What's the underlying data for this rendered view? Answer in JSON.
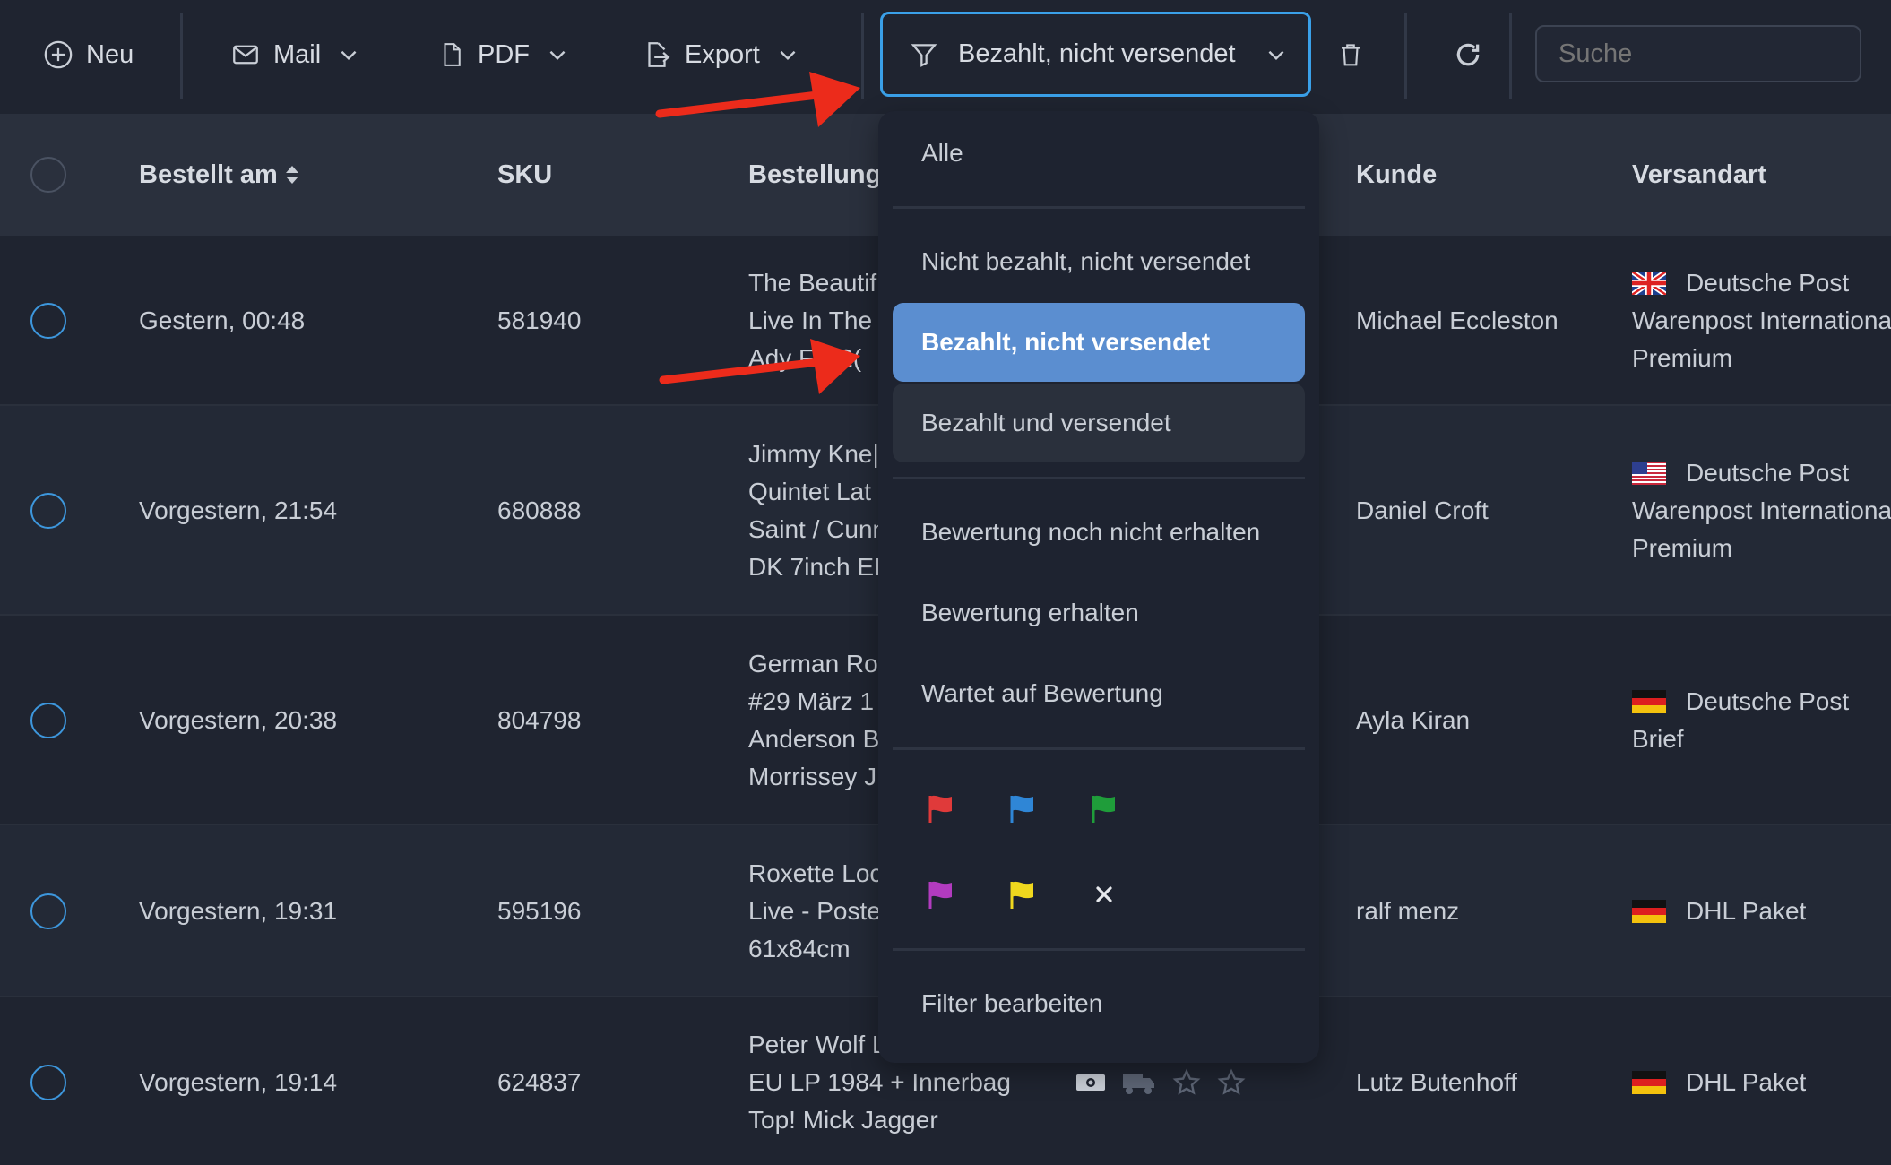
{
  "toolbar": {
    "new_label": "Neu",
    "mail_label": "Mail",
    "pdf_label": "PDF",
    "export_label": "Export",
    "filter_label": "Bezahlt, nicht versendet",
    "search_placeholder": "Suche"
  },
  "table": {
    "headers": {
      "ordered_at": "Bestellt am",
      "sku": "SKU",
      "order": "Bestellung",
      "customer": "Kunde",
      "shipping": "Versandart"
    },
    "rows": [
      {
        "date": "Gestern, 00:48",
        "sku": "581940",
        "order_lines": [
          "The Beautif",
          "Live In The",
          "Ady F... 2("
        ],
        "customer": "Michael Eccleston",
        "flag": "uk",
        "shipping_lines": [
          "Deutsche Post",
          "Warenpost Internationa",
          "Premium"
        ]
      },
      {
        "date": "Vorgestern, 21:54",
        "sku": "680888",
        "order_lines": [
          "Jimmy Kne|",
          "Quintet Lat",
          "Saint / Cunn",
          "DK 7inch EI"
        ],
        "customer": "Daniel Croft",
        "flag": "us",
        "shipping_lines": [
          "Deutsche Post",
          "Warenpost Internationa",
          "Premium"
        ]
      },
      {
        "date": "Vorgestern, 20:38",
        "sku": "804798",
        "order_lines": [
          "German Ro",
          "#29 März 1",
          "Anderson B",
          "Morrissey J"
        ],
        "customer": "Ayla Kiran",
        "flag": "de",
        "shipping_lines": [
          "Deutsche Post",
          "Brief"
        ]
      },
      {
        "date": "Vorgestern, 19:31",
        "sku": "595196",
        "order_lines": [
          "Roxette Loc",
          "Live - Poste",
          "61x84cm"
        ],
        "customer": "ralf menz",
        "flag": "de",
        "shipping_lines": [
          "DHL Paket"
        ]
      },
      {
        "date": "Vorgestern, 19:14",
        "sku": "624837",
        "order_lines": [
          "Peter Wolf L",
          "EU LP 1984 + Innerbag",
          "Top! Mick Jagger"
        ],
        "customer": "Lutz Butenhoff",
        "flag": "de",
        "shipping_lines": [
          "DHL Paket"
        ],
        "status_icons": [
          "money-icon",
          "truck-icon",
          "star-icon",
          "star-icon"
        ]
      }
    ]
  },
  "dropdown": {
    "all": "Alle",
    "not_paid_not_shipped": "Nicht bezahlt, nicht versendet",
    "paid_not_shipped": "Bezahlt, nicht versendet",
    "paid_and_shipped": "Bezahlt und versendet",
    "rating_not_received": "Bewertung noch nicht erhalten",
    "rating_received": "Bewertung erhalten",
    "awaiting_rating": "Wartet auf Bewertung",
    "edit_filter": "Filter bearbeiten",
    "flag_colors": [
      "#e03a3a",
      "#2f86d6",
      "#1f9d3a",
      "#b23bbf",
      "#f0d81e"
    ]
  },
  "colors": {
    "accent": "#3aa0e8",
    "active_item": "#5b8ed0",
    "annotation_arrow": "#ec2b1b"
  }
}
